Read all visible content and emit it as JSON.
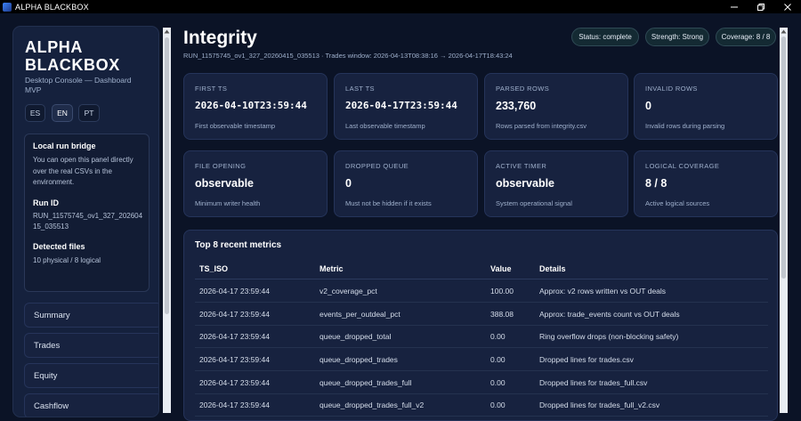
{
  "window": {
    "title": "ALPHA BLACKBOX"
  },
  "sidebar": {
    "brand_line1": "ALPHA",
    "brand_line2": "BLACKBOX",
    "subtitle": "Desktop Console — Dashboard MVP",
    "languages": [
      {
        "code": "ES",
        "active": false
      },
      {
        "code": "EN",
        "active": true
      },
      {
        "code": "PT",
        "active": false
      }
    ],
    "bridge": {
      "heading": "Local run bridge",
      "text": "You can open this panel directly over the real CSVs in the environment.",
      "run_id_heading": "Run ID",
      "run_id": "RUN_11575745_ov1_327_20260415_035513",
      "detected_heading": "Detected files",
      "detected_value": "10 physical / 8 logical"
    },
    "nav": [
      {
        "label": "Summary"
      },
      {
        "label": "Trades"
      },
      {
        "label": "Equity"
      },
      {
        "label": "Cashflow"
      }
    ]
  },
  "header": {
    "title": "Integrity",
    "meta": "RUN_11575745_ov1_327_20260415_035513 · Trades window: 2026-04-13T08:38:16 → 2026-04-17T18:43:24",
    "badges": [
      {
        "label": "Status: complete"
      },
      {
        "label": "Strength: Strong"
      },
      {
        "label": "Coverage: 8 / 8"
      }
    ]
  },
  "cards": [
    {
      "label": "FIRST TS",
      "value": "2026-04-10T23:59:44",
      "desc": "First observable timestamp",
      "mono": true
    },
    {
      "label": "LAST TS",
      "value": "2026-04-17T23:59:44",
      "desc": "Last observable timestamp",
      "mono": true
    },
    {
      "label": "PARSED ROWS",
      "value": "233,760",
      "desc": "Rows parsed from integrity.csv",
      "mono": false
    },
    {
      "label": "INVALID ROWS",
      "value": "0",
      "desc": "Invalid rows during parsing",
      "mono": false
    },
    {
      "label": "FILE OPENING",
      "value": "observable",
      "desc": "Minimum writer health",
      "mono": false
    },
    {
      "label": "DROPPED QUEUE",
      "value": "0",
      "desc": "Must not be hidden if it exists",
      "mono": false
    },
    {
      "label": "ACTIVE TIMER",
      "value": "observable",
      "desc": "System operational signal",
      "mono": false
    },
    {
      "label": "LOGICAL COVERAGE",
      "value": "8 / 8",
      "desc": "Active logical sources",
      "mono": false
    }
  ],
  "table": {
    "title": "Top 8 recent metrics",
    "columns": [
      "TS_ISO",
      "Metric",
      "Value",
      "Details"
    ],
    "rows": [
      [
        "2026-04-17 23:59:44",
        "v2_coverage_pct",
        "100.00",
        "Approx: v2 rows written vs OUT deals"
      ],
      [
        "2026-04-17 23:59:44",
        "events_per_outdeal_pct",
        "388.08",
        "Approx: trade_events count vs OUT deals"
      ],
      [
        "2026-04-17 23:59:44",
        "queue_dropped_total",
        "0.00",
        "Ring overflow drops (non-blocking safety)"
      ],
      [
        "2026-04-17 23:59:44",
        "queue_dropped_trades",
        "0.00",
        "Dropped lines for trades.csv"
      ],
      [
        "2026-04-17 23:59:44",
        "queue_dropped_trades_full",
        "0.00",
        "Dropped lines for trades_full.csv"
      ],
      [
        "2026-04-17 23:59:44",
        "queue_dropped_trades_full_v2",
        "0.00",
        "Dropped lines for trades_full_v2.csv"
      ]
    ]
  }
}
